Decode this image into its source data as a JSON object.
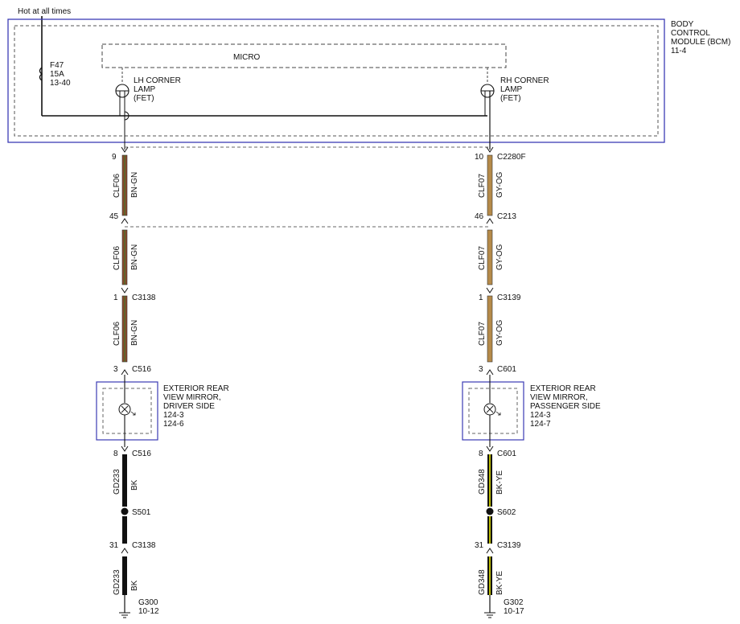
{
  "header": {
    "power_label": "Hot at all times"
  },
  "bcm": {
    "title_lines": [
      "BODY",
      "CONTROL",
      "MODULE (BCM)",
      "11-4"
    ],
    "micro_label": "MICRO",
    "fuse_lines": [
      "F47",
      "15A",
      "13-40"
    ],
    "lh_lamp_lines": [
      "LH CORNER",
      "LAMP",
      "(FET)"
    ],
    "rh_lamp_lines": [
      "RH CORNER",
      "LAMP",
      "(FET)"
    ]
  },
  "left": {
    "wire_color": "#8b4a2b",
    "pins": {
      "bcm": {
        "pin": "9",
        "connector": ""
      },
      "c213": {
        "pin": "45",
        "connector": ""
      },
      "c3138": {
        "pin": "1",
        "connector": "C3138"
      },
      "c516_in": {
        "pin": "3",
        "connector": "C516"
      },
      "c516_out": {
        "pin": "8",
        "connector": "C516"
      },
      "s501": {
        "connector": "S501"
      },
      "c3138b": {
        "pin": "31",
        "connector": "C3138"
      },
      "ground": {
        "connector": "G300",
        "ref": "10-12"
      }
    },
    "segments": [
      {
        "circuit": "CLF06",
        "color_code": "BN-GN"
      },
      {
        "circuit": "CLF06",
        "color_code": "BN-GN"
      },
      {
        "circuit": "CLF06",
        "color_code": "BN-GN"
      },
      {
        "circuit": "GD233",
        "color_code": "BK"
      },
      {
        "circuit": "GD233",
        "color_code": "BK"
      }
    ],
    "component_lines": [
      "EXTERIOR REAR",
      "VIEW MIRROR,",
      "DRIVER SIDE",
      "124-3",
      "124-6"
    ]
  },
  "right": {
    "wire_color": "#b58a4a",
    "pins": {
      "bcm": {
        "pin": "10",
        "connector": "C2280F"
      },
      "c213": {
        "pin": "46",
        "connector": "C213"
      },
      "c3139": {
        "pin": "1",
        "connector": "C3139"
      },
      "c601_in": {
        "pin": "3",
        "connector": "C601"
      },
      "c601_out": {
        "pin": "8",
        "connector": "C601"
      },
      "s602": {
        "connector": "S602"
      },
      "c3139b": {
        "pin": "31",
        "connector": "C3139"
      },
      "ground": {
        "connector": "G302",
        "ref": "10-17"
      }
    },
    "segments": [
      {
        "circuit": "CLF07",
        "color_code": "GY-OG"
      },
      {
        "circuit": "CLF07",
        "color_code": "GY-OG"
      },
      {
        "circuit": "CLF07",
        "color_code": "GY-OG"
      },
      {
        "circuit": "GD348",
        "color_code": "BK-YE"
      },
      {
        "circuit": "GD348",
        "color_code": "BK-YE"
      }
    ],
    "component_lines": [
      "EXTERIOR REAR",
      "VIEW MIRROR,",
      "PASSENGER SIDE",
      "124-3",
      "124-7"
    ]
  },
  "colors": {
    "module_border": "#3b3bb5",
    "wire_black": "#111111",
    "wire_yellow": "#e6e600",
    "wire_green": "#2f7d2f"
  }
}
